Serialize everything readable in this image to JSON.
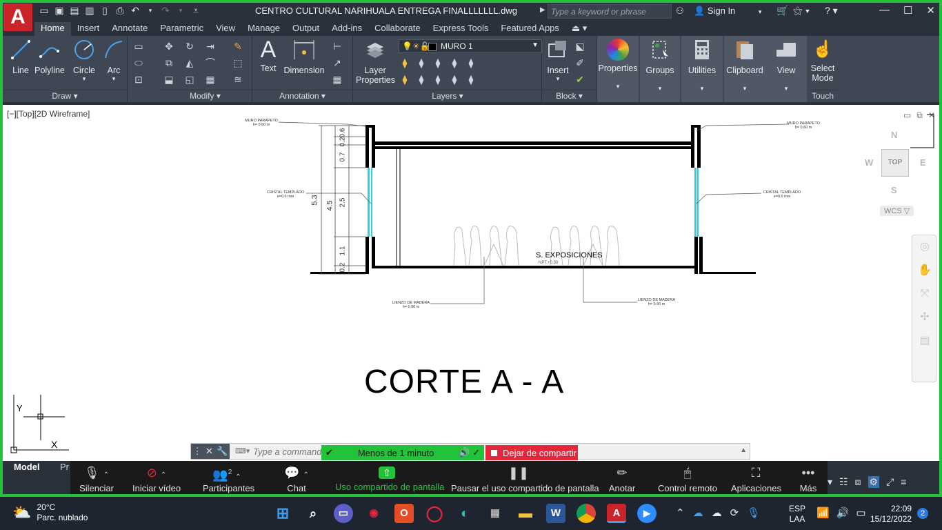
{
  "window": {
    "app_logo": "A",
    "doc_title": "CENTRO CULTURAL NARIHUALA ENTREGA FINALLLLLLL.dwg",
    "search_placeholder": "Type a keyword or phrase",
    "sign_in": "Sign In"
  },
  "tabs": [
    "Home",
    "Insert",
    "Annotate",
    "Parametric",
    "View",
    "Manage",
    "Output",
    "Add-ins",
    "Collaborate",
    "Express Tools",
    "Featured Apps"
  ],
  "ribbon": {
    "draw": {
      "title": "Draw",
      "line": "Line",
      "polyline": "Polyline",
      "circle": "Circle",
      "arc": "Arc"
    },
    "modify": {
      "title": "Modify"
    },
    "annotation": {
      "title": "Annotation",
      "text": "Text",
      "dimension": "Dimension"
    },
    "layers": {
      "title": "Layers",
      "layer_properties_1": "Layer",
      "layer_properties_2": "Properties",
      "current_layer": "MURO 1"
    },
    "block": {
      "title": "Block",
      "insert": "Insert"
    },
    "properties": "Properties",
    "groups": "Groups",
    "utilities": "Utilities",
    "clipboard": "Clipboard",
    "view": "View",
    "select_mode_1": "Select",
    "select_mode_2": "Mode",
    "touch": "Touch"
  },
  "viewport": {
    "label": "[−][Top][2D Wireframe]",
    "viewcube_face": "TOP",
    "compass": {
      "n": "N",
      "s": "S",
      "e": "E",
      "w": "W"
    },
    "wcs": "WCS ▽"
  },
  "drawing": {
    "title": "CORTE A - A",
    "room_label": "S. EXPOSICIONES",
    "npt": "NPT.+0.30",
    "left_wall_label": "MURO PARAPETO",
    "left_wall_sub": "h= 0.60 m",
    "right_wall_label": "MURO PARAPETO",
    "right_wall_sub": "h= 0.60 m",
    "left_glass_label": "CRISTAL TEMPLADO",
    "left_glass_sub": "e=0.6 mm",
    "right_glass_label": "CRISTAL TEMPLADO",
    "right_glass_sub": "e=0.6 mm",
    "left_lienzo_label": "LIENZO DE MADERA",
    "left_lienzo_sub": "h= 0.90 m",
    "right_lienzo_label": "LIENZO DE MADERA",
    "right_lienzo_sub": "h= 0.90 m",
    "dims": {
      "total": "5.3",
      "inner": "4.5",
      "d06": "0.6",
      "d02": "0.2",
      "d07": "0.7",
      "d25": "2.5",
      "d11": "1.1",
      "d02b": "0.2"
    },
    "ucs_x": "X",
    "ucs_y": "Y"
  },
  "command": {
    "placeholder": "Type a command"
  },
  "share": {
    "timer": "Menos de 1 minuto",
    "stop": "Dejar de compartir"
  },
  "layout_tabs": {
    "model": "Model",
    "layout": "Pr"
  },
  "zoom": {
    "mute": "Silenciar",
    "video": "Iniciar vídeo",
    "participants": "Participantes",
    "participants_count": "2",
    "chat": "Chat",
    "share": "Uso compartido de pantalla",
    "pause": "Pausar el uso compartido de pantalla",
    "annotate": "Anotar",
    "remote": "Control remoto",
    "apps": "Aplicaciones",
    "more": "Más"
  },
  "taskbar": {
    "temp": "20°C",
    "weather": "Parc. nublado",
    "lang_1": "ESP",
    "lang_2": "LAA",
    "time": "22:09",
    "date": "15/12/2022",
    "notifications": "2"
  },
  "colors": {
    "share_green": "#22c33a",
    "stop_red": "#e5263b",
    "autocad_red": "#c8242a",
    "glass_cyan": "#29d3e6"
  }
}
